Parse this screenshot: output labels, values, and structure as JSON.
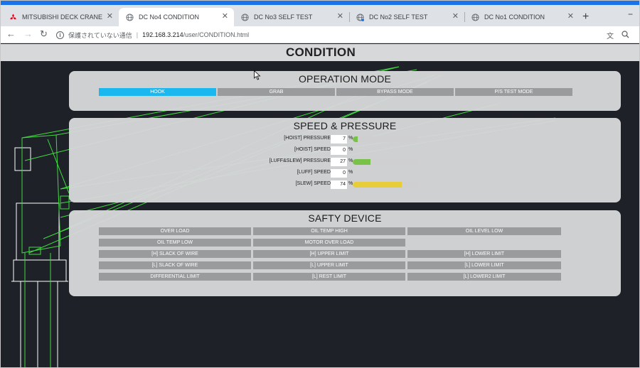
{
  "browser": {
    "tabs": [
      {
        "label": "MITSUBISHI DECK CRANE",
        "active": false
      },
      {
        "label": "DC No4 CONDITION",
        "active": true
      },
      {
        "label": "DC No3 SELF TEST",
        "active": false
      },
      {
        "label": "DC No2 SELF TEST",
        "active": false
      },
      {
        "label": "DC No1 CONDITION",
        "active": false
      }
    ],
    "new_tab_label": "+",
    "minimize_label": "−",
    "security_text": "保護されていない通信",
    "url_host": "192.168.3.214",
    "url_path": "/user/CONDITION.html"
  },
  "page": {
    "title": "CONDITION"
  },
  "operation_mode": {
    "title": "OPERATION MODE",
    "buttons": [
      {
        "label": "HOOK",
        "active": true
      },
      {
        "label": "GRAB",
        "active": false
      },
      {
        "label": "BYPASS MODE",
        "active": false
      },
      {
        "label": "P/S TEST MODE",
        "active": false
      }
    ]
  },
  "speed_pressure": {
    "title": "SPEED & PRESSURE",
    "unit": "%",
    "rows": [
      {
        "label": "[HOIST] PRESSURE",
        "value": "7",
        "fraction": 0.07,
        "color": "#79c24a"
      },
      {
        "label": "[HOIST] SPEED",
        "value": "0",
        "fraction": 0.0,
        "color": "#79c24a"
      },
      {
        "label": "[LUFF&SLEW] PRESSURE",
        "value": "27",
        "fraction": 0.27,
        "color": "#79c24a"
      },
      {
        "label": "[LUFF] SPEED",
        "value": "0",
        "fraction": 0.0,
        "color": "#79c24a"
      },
      {
        "label": "[SLEW] SPEED",
        "value": "74",
        "fraction": 0.74,
        "color": "#e8cd3b"
      }
    ]
  },
  "safety_device": {
    "title": "SAFTY DEVICE",
    "rows": [
      [
        "OVER LOAD",
        "OIL TEMP HIGH",
        "OIL LEVEL LOW"
      ],
      [
        "OIL TEMP LOW",
        "MOTOR OVER LOAD",
        ""
      ],
      [
        "[H] SLACK OF WIRE",
        "[H] UPPER LIMIT",
        "[H] LOWER LIMIT"
      ],
      [
        "[L] SLACK OF WIRE",
        "[L] UPPER LIMIT",
        "[L] LOWER LIMIT"
      ],
      [
        "DIFFERENTIAL LIMIT",
        "[L] REST LIMIT",
        "[L] LOWER2 LIMIT"
      ]
    ]
  }
}
